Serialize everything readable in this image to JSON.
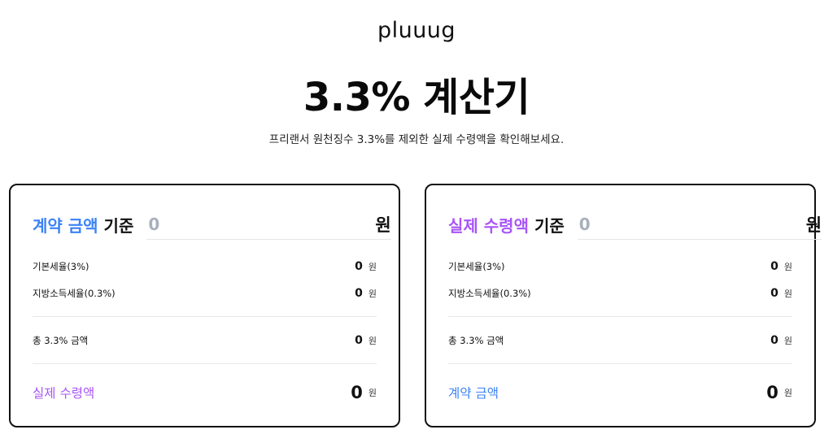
{
  "header": {
    "logo": "pluuug",
    "title": "3.3% 계산기",
    "subtitle": "프리랜서 원천징수 3.3%를 제외한 실제 수령액을 확인해보세요."
  },
  "colors": {
    "blue": "#3b82f6",
    "purple": "#a855f7"
  },
  "left_card": {
    "label_colored": "계약 금액",
    "label_plain": "기준",
    "input_placeholder": "0",
    "unit": "원",
    "rows": [
      {
        "label": "기본세율(3%)",
        "value": "0",
        "unit": "원"
      },
      {
        "label": "지방소득세율(0.3%)",
        "value": "0",
        "unit": "원"
      },
      {
        "label": "총 3.3% 금액",
        "value": "0",
        "unit": "원"
      },
      {
        "label": "실제 수령액",
        "value": "0",
        "unit": "원"
      }
    ]
  },
  "right_card": {
    "label_colored": "실제 수령액",
    "label_plain": "기준",
    "input_placeholder": "0",
    "unit": "원",
    "rows": [
      {
        "label": "기본세율(3%)",
        "value": "0",
        "unit": "원"
      },
      {
        "label": "지방소득세율(0.3%)",
        "value": "0",
        "unit": "원"
      },
      {
        "label": "총 3.3% 금액",
        "value": "0",
        "unit": "원"
      },
      {
        "label": "계약 금액",
        "value": "0",
        "unit": "원"
      }
    ]
  }
}
